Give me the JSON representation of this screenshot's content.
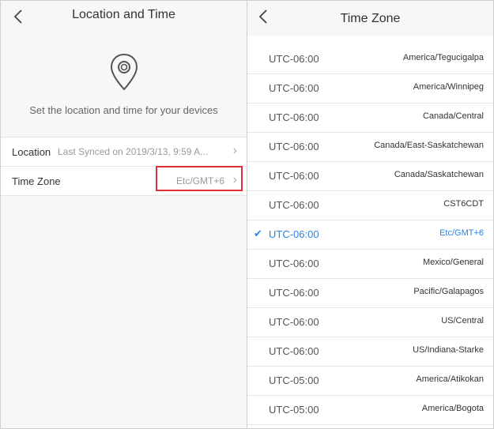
{
  "left": {
    "title": "Location and Time",
    "description": "Set the location and time for your devices",
    "rows": [
      {
        "label": "Location",
        "value": "Last Synced on 2019/3/13, 9:59 A..."
      },
      {
        "label": "Time Zone",
        "value": "Etc/GMT+6"
      }
    ],
    "icons": {
      "back": "chevron-left-icon",
      "pin": "location-pin-icon",
      "row": "chevron-right-icon"
    }
  },
  "right": {
    "title": "Time Zone",
    "items": [
      {
        "offset": "UTC-06:00",
        "name": "America/Tegucigalpa",
        "selected": false
      },
      {
        "offset": "UTC-06:00",
        "name": "America/Winnipeg",
        "selected": false
      },
      {
        "offset": "UTC-06:00",
        "name": "Canada/Central",
        "selected": false
      },
      {
        "offset": "UTC-06:00",
        "name": "Canada/East-Saskatchewan",
        "selected": false
      },
      {
        "offset": "UTC-06:00",
        "name": "Canada/Saskatchewan",
        "selected": false
      },
      {
        "offset": "UTC-06:00",
        "name": "CST6CDT",
        "selected": false
      },
      {
        "offset": "UTC-06:00",
        "name": "Etc/GMT+6",
        "selected": true
      },
      {
        "offset": "UTC-06:00",
        "name": "Mexico/General",
        "selected": false
      },
      {
        "offset": "UTC-06:00",
        "name": "Pacific/Galapagos",
        "selected": false
      },
      {
        "offset": "UTC-06:00",
        "name": "US/Central",
        "selected": false
      },
      {
        "offset": "UTC-06:00",
        "name": "US/Indiana-Starke",
        "selected": false
      },
      {
        "offset": "UTC-05:00",
        "name": "America/Atikokan",
        "selected": false
      },
      {
        "offset": "UTC-05:00",
        "name": "America/Bogota",
        "selected": false
      }
    ],
    "check_glyph": "✔"
  },
  "colors": {
    "accent": "#2a84e8",
    "highlight": "#e0303a"
  }
}
